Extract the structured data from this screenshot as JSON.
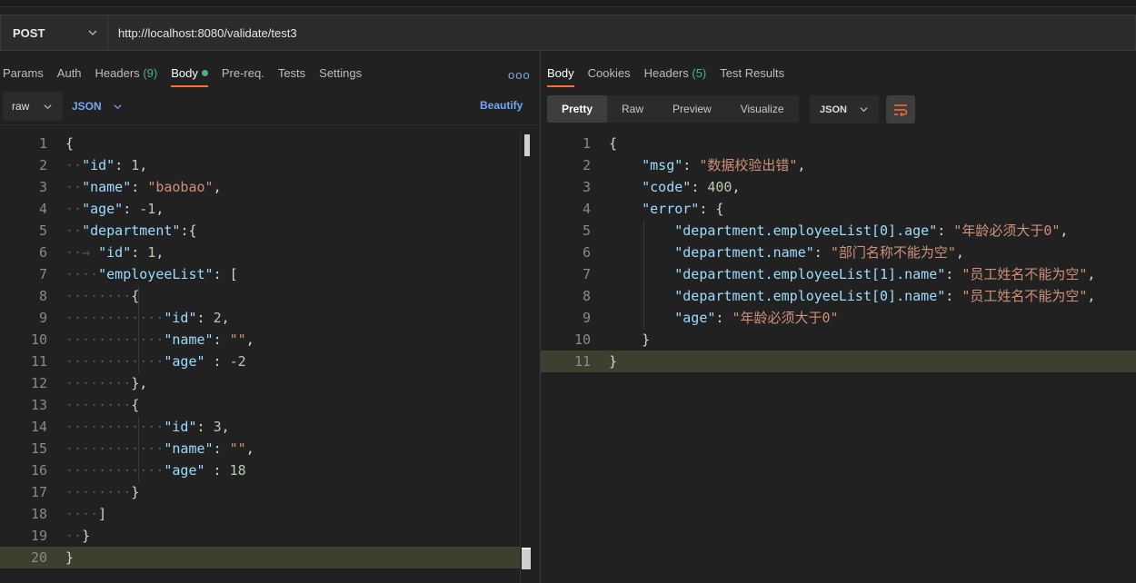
{
  "request": {
    "method": "POST",
    "url": "http://localhost:8080/validate/test3"
  },
  "request_tabs": {
    "params": "Params",
    "auth": "Auth",
    "headers": "Headers",
    "headers_count": "(9)",
    "body": "Body",
    "prereq": "Pre-req.",
    "tests": "Tests",
    "settings": "Settings",
    "more": "ooo"
  },
  "body_toolbar": {
    "mode": "raw",
    "language": "JSON",
    "beautify": "Beautify"
  },
  "response_tabs": {
    "body": "Body",
    "cookies": "Cookies",
    "headers": "Headers",
    "headers_count": "(5)",
    "test_results": "Test Results"
  },
  "response_toolbar": {
    "pretty": "Pretty",
    "raw": "Raw",
    "preview": "Preview",
    "visualize": "Visualize",
    "format": "JSON"
  },
  "request_body_lines": [
    [
      [
        "p",
        "{"
      ]
    ],
    [
      [
        "ws",
        "··"
      ],
      [
        "k",
        "\"id\""
      ],
      [
        "p",
        ": "
      ],
      [
        "n",
        "1"
      ],
      [
        "p",
        ","
      ]
    ],
    [
      [
        "ws",
        "··"
      ],
      [
        "k",
        "\"name\""
      ],
      [
        "p",
        ": "
      ],
      [
        "s",
        "\"baobao\""
      ],
      [
        "p",
        ","
      ]
    ],
    [
      [
        "ws",
        "··"
      ],
      [
        "k",
        "\"age\""
      ],
      [
        "p",
        ": "
      ],
      [
        "n",
        "-1"
      ],
      [
        "p",
        ","
      ]
    ],
    [
      [
        "ws",
        "··"
      ],
      [
        "k",
        "\"department\""
      ],
      [
        "p",
        ":{"
      ]
    ],
    [
      [
        "ws",
        "··→ "
      ],
      [
        "k",
        "\"id\""
      ],
      [
        "p",
        ": "
      ],
      [
        "n",
        "1"
      ],
      [
        "p",
        ","
      ]
    ],
    [
      [
        "ws",
        "····"
      ],
      [
        "k",
        "\"employeeList\""
      ],
      [
        "p",
        ": ["
      ]
    ],
    [
      [
        "ws",
        "········"
      ],
      [
        "p",
        "{"
      ]
    ],
    [
      [
        "ws",
        "············"
      ],
      [
        "k",
        "\"id\""
      ],
      [
        "p",
        ": "
      ],
      [
        "n",
        "2"
      ],
      [
        "p",
        ","
      ]
    ],
    [
      [
        "ws",
        "············"
      ],
      [
        "k",
        "\"name\""
      ],
      [
        "p",
        ": "
      ],
      [
        "s",
        "\"\""
      ],
      [
        "p",
        ","
      ]
    ],
    [
      [
        "ws",
        "············"
      ],
      [
        "k",
        "\"age\""
      ],
      [
        "p",
        " : "
      ],
      [
        "n",
        "-2"
      ]
    ],
    [
      [
        "ws",
        "········"
      ],
      [
        "p",
        "},"
      ]
    ],
    [
      [
        "ws",
        "········"
      ],
      [
        "p",
        "{"
      ]
    ],
    [
      [
        "ws",
        "············"
      ],
      [
        "k",
        "\"id\""
      ],
      [
        "p",
        ": "
      ],
      [
        "n",
        "3"
      ],
      [
        "p",
        ","
      ]
    ],
    [
      [
        "ws",
        "············"
      ],
      [
        "k",
        "\"name\""
      ],
      [
        "p",
        ": "
      ],
      [
        "s",
        "\"\""
      ],
      [
        "p",
        ","
      ]
    ],
    [
      [
        "ws",
        "············"
      ],
      [
        "k",
        "\"age\""
      ],
      [
        "p",
        " : "
      ],
      [
        "n",
        "18"
      ]
    ],
    [
      [
        "ws",
        "········"
      ],
      [
        "p",
        "}"
      ]
    ],
    [
      [
        "ws",
        "····"
      ],
      [
        "p",
        "]"
      ]
    ],
    [
      [
        "ws",
        "··"
      ],
      [
        "p",
        "}"
      ]
    ],
    [
      [
        "p",
        "}"
      ]
    ]
  ],
  "response_body_lines": [
    [
      [
        "p",
        "{"
      ]
    ],
    [
      [
        "p",
        "    "
      ],
      [
        "k",
        "\"msg\""
      ],
      [
        "p",
        ": "
      ],
      [
        "s",
        "\"数据校验出错\""
      ],
      [
        "p",
        ","
      ]
    ],
    [
      [
        "p",
        "    "
      ],
      [
        "k",
        "\"code\""
      ],
      [
        "p",
        ": "
      ],
      [
        "n",
        "400"
      ],
      [
        "p",
        ","
      ]
    ],
    [
      [
        "p",
        "    "
      ],
      [
        "k",
        "\"error\""
      ],
      [
        "p",
        ": {"
      ]
    ],
    [
      [
        "p",
        "        "
      ],
      [
        "k",
        "\"department.employeeList[0].age\""
      ],
      [
        "p",
        ": "
      ],
      [
        "s",
        "\"年龄必须大于0\""
      ],
      [
        "p",
        ","
      ]
    ],
    [
      [
        "p",
        "        "
      ],
      [
        "k",
        "\"department.name\""
      ],
      [
        "p",
        ": "
      ],
      [
        "s",
        "\"部门名称不能为空\""
      ],
      [
        "p",
        ","
      ]
    ],
    [
      [
        "p",
        "        "
      ],
      [
        "k",
        "\"department.employeeList[1].name\""
      ],
      [
        "p",
        ": "
      ],
      [
        "s",
        "\"员工姓名不能为空\""
      ],
      [
        "p",
        ","
      ]
    ],
    [
      [
        "p",
        "        "
      ],
      [
        "k",
        "\"department.employeeList[0].name\""
      ],
      [
        "p",
        ": "
      ],
      [
        "s",
        "\"员工姓名不能为空\""
      ],
      [
        "p",
        ","
      ]
    ],
    [
      [
        "p",
        "        "
      ],
      [
        "k",
        "\"age\""
      ],
      [
        "p",
        ": "
      ],
      [
        "s",
        "\"年龄必须大于0\""
      ]
    ],
    [
      [
        "p",
        "    }"
      ]
    ],
    [
      [
        "p",
        "}"
      ]
    ]
  ],
  "colors": {
    "accent": "#ff6c37",
    "key": "#9cdcfe",
    "string": "#ce9178",
    "number": "#b5cea8",
    "link": "#6fa8f5",
    "count": "#49b675"
  }
}
